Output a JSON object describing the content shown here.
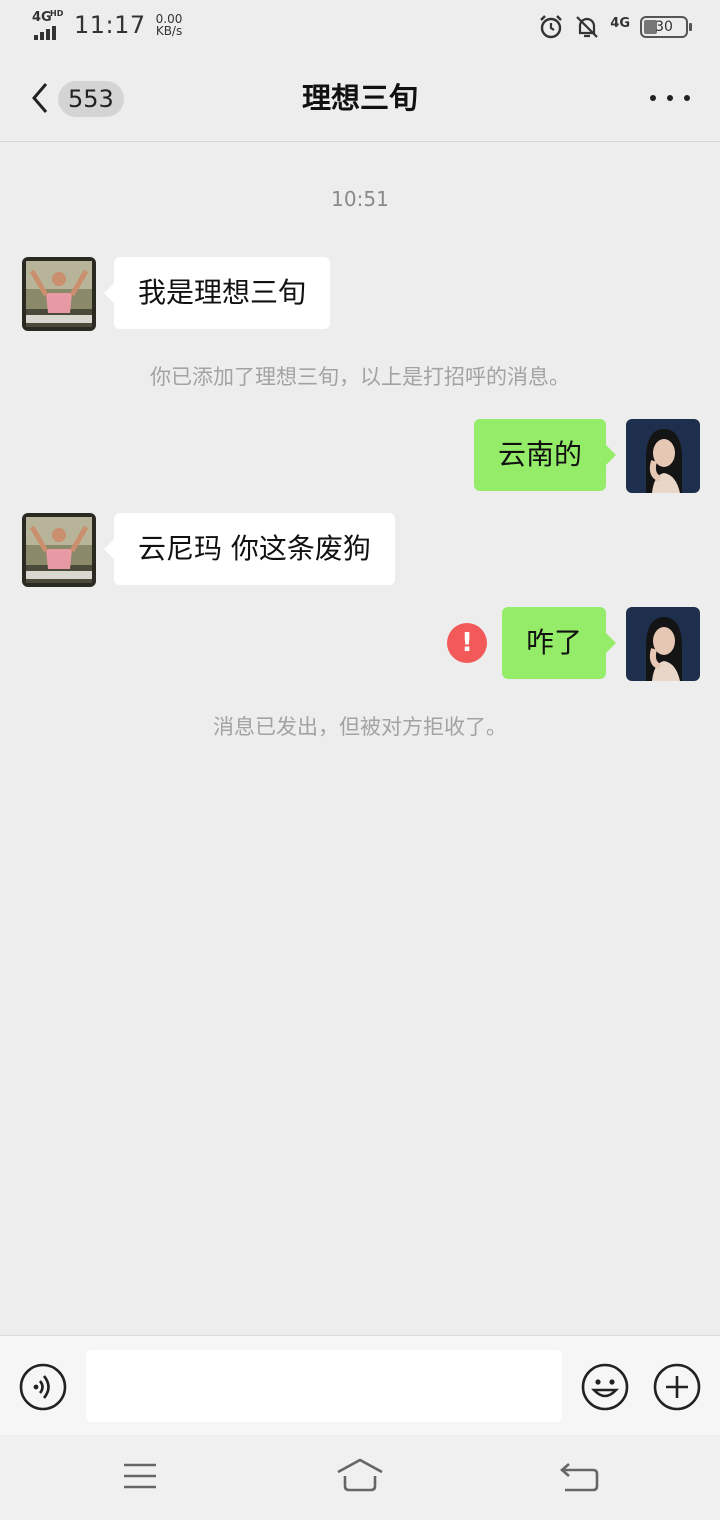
{
  "status_bar": {
    "network": "4G",
    "network_hd": "HD",
    "time": "11:17",
    "speed_value": "0.00",
    "speed_unit": "KB/s",
    "network_right": "4G",
    "battery": "30",
    "icons": [
      "alarm-icon",
      "mute-bell-icon"
    ]
  },
  "nav": {
    "unread_count": "553",
    "title": "理想三旬"
  },
  "chat": {
    "timestamp": "10:51",
    "messages": [
      {
        "side": "left",
        "text": "我是理想三旬"
      },
      {
        "side": "system",
        "text": "你已添加了理想三旬，以上是打招呼的消息。"
      },
      {
        "side": "right",
        "text": "云南的"
      },
      {
        "side": "left",
        "text": "云尼玛 你这条废狗"
      },
      {
        "side": "right",
        "text": "咋了",
        "status": "failed",
        "status_symbol": "!"
      },
      {
        "side": "system",
        "text": "消息已发出，但被对方拒收了。"
      }
    ]
  },
  "input": {
    "placeholder": ""
  },
  "colors": {
    "background": "#ededed",
    "bubble_self": "#95ec69",
    "bubble_other": "#ffffff",
    "error": "#f25a5a"
  }
}
